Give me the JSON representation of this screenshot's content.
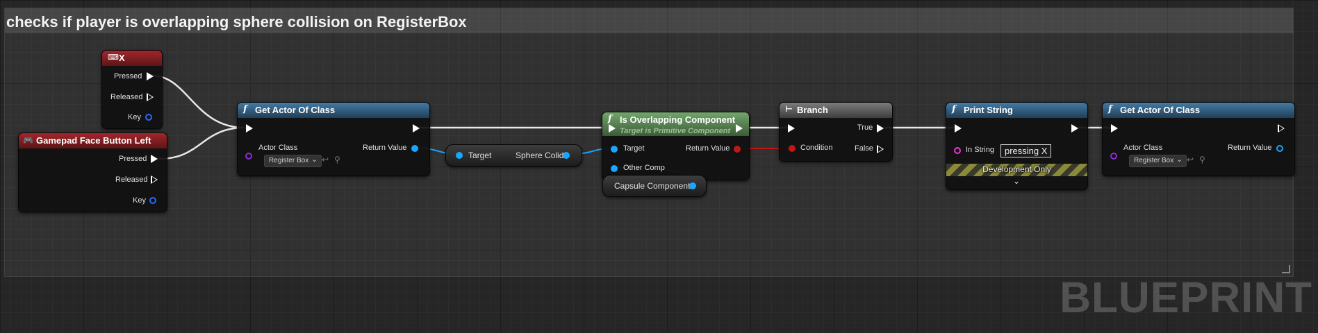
{
  "comment": {
    "title": "checks if player is overlapping sphere collision on RegisterBox"
  },
  "watermark": "BLUEPRINT",
  "colors": {
    "exec": "#ffffff",
    "object": "#19a6ff",
    "bool": "#c11616",
    "string": "#f331dc",
    "class": "#8d2bd8"
  },
  "nodes": {
    "key_x": {
      "icon": "keyboard-icon",
      "title": "X",
      "pressed": "Pressed",
      "released": "Released",
      "key": "Key"
    },
    "gamepad": {
      "icon": "gamepad-icon",
      "title": "Gamepad Face Button Left",
      "pressed": "Pressed",
      "released": "Released",
      "key": "Key"
    },
    "get_actor_1": {
      "glyph": "f",
      "title": "Get Actor Of Class",
      "actor_class": "Actor Class",
      "actor_class_value": "Register Box",
      "return_value": "Return Value"
    },
    "sphere_getter": {
      "target": "Target",
      "output": "Sphere Colid"
    },
    "is_overlapping": {
      "glyph": "f",
      "title": "Is Overlapping Component",
      "subtitle": "Target is Primitive Component",
      "target": "Target",
      "other_comp": "Other Comp",
      "return_value": "Return Value"
    },
    "capsule": {
      "label": "Capsule Component"
    },
    "branch": {
      "title": "Branch",
      "condition": "Condition",
      "true_label": "True",
      "false_label": "False"
    },
    "print_string": {
      "glyph": "f",
      "title": "Print String",
      "in_string": "In String",
      "in_string_value": "pressing X",
      "dev_only": "Development Only"
    },
    "get_actor_2": {
      "glyph": "f",
      "title": "Get Actor Of Class",
      "actor_class": "Actor Class",
      "actor_class_value": "Register Box",
      "return_value": "Return Value"
    }
  }
}
